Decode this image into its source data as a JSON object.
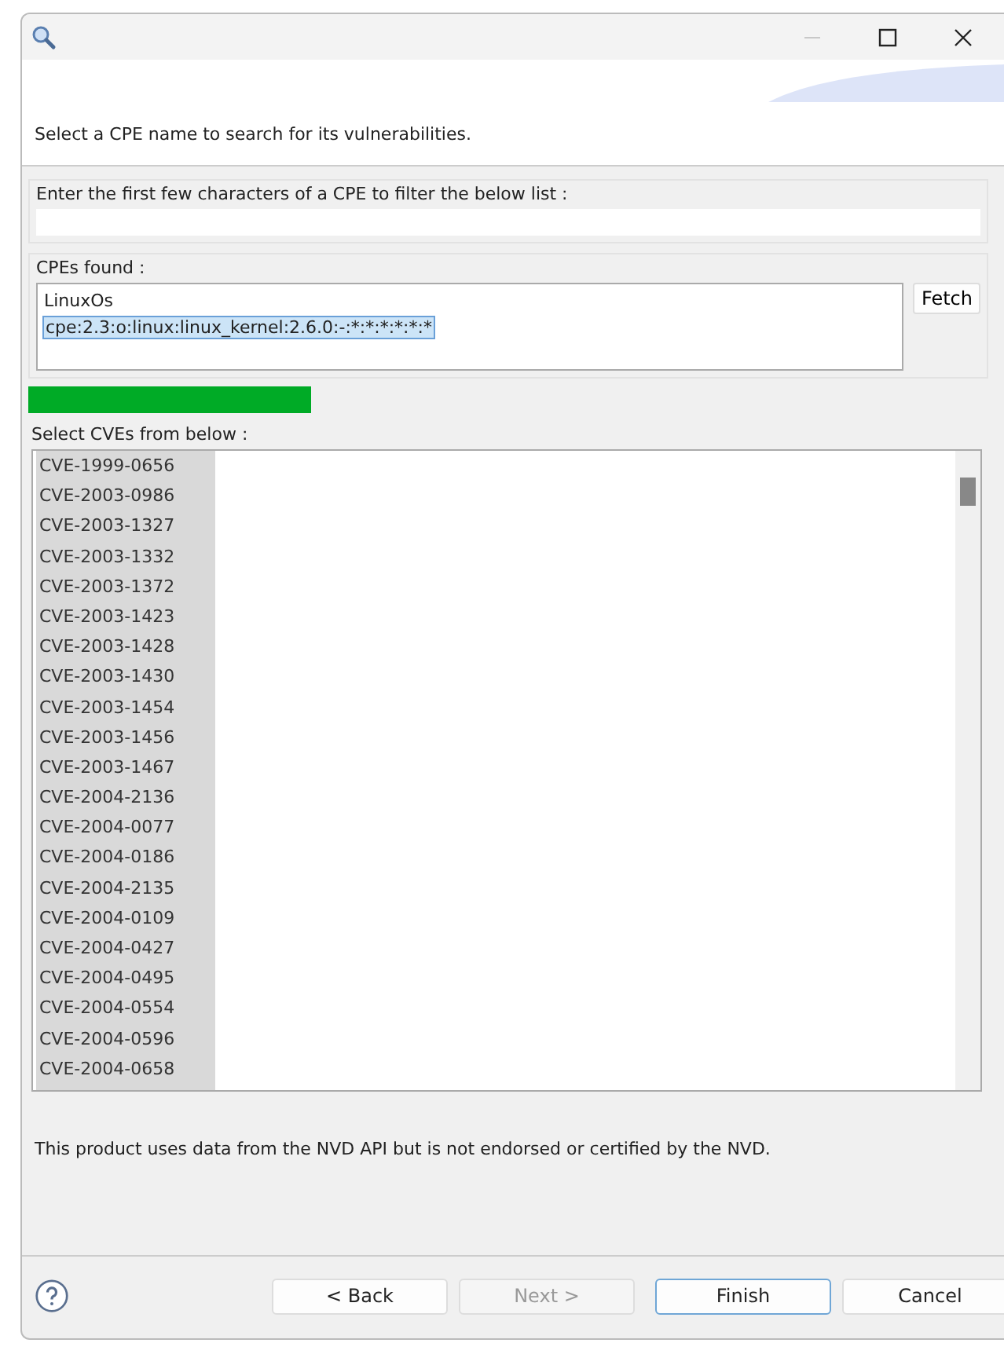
{
  "header": {
    "message": "Select a CPE name to search for its vulnerabilities."
  },
  "filter": {
    "label": "Enter the first few characters of a CPE to filter the below list :"
  },
  "cpes": {
    "label": "CPEs found :",
    "items": [
      {
        "text": "LinuxOs",
        "selected": false
      },
      {
        "text": "cpe:2.3:o:linux:linux_kernel:2.6.0:-:*:*:*:*:*:*",
        "selected": true
      }
    ],
    "fetch": "Fetch"
  },
  "cves": {
    "label": "Select CVEs from below :",
    "items": [
      "CVE-1999-0656",
      "CVE-2003-0986",
      "CVE-2003-1327",
      "CVE-2003-1332",
      "CVE-2003-1372",
      "CVE-2003-1423",
      "CVE-2003-1428",
      "CVE-2003-1430",
      "CVE-2003-1454",
      "CVE-2003-1456",
      "CVE-2003-1467",
      "CVE-2004-2136",
      "CVE-2004-0077",
      "CVE-2004-0186",
      "CVE-2004-2135",
      "CVE-2004-0109",
      "CVE-2004-0427",
      "CVE-2004-0495",
      "CVE-2004-0554",
      "CVE-2004-0596",
      "CVE-2004-0658"
    ]
  },
  "notice": "This product uses data from the NVD API but is not endorsed or certified by the NVD.",
  "buttons": [
    {
      "label": "< Back",
      "disabled": false,
      "default": false
    },
    {
      "label": "Next >",
      "disabled": true,
      "default": false
    },
    {
      "label": "Finish",
      "disabled": false,
      "default": true
    },
    {
      "label": "Cancel",
      "disabled": false,
      "default": false
    }
  ]
}
